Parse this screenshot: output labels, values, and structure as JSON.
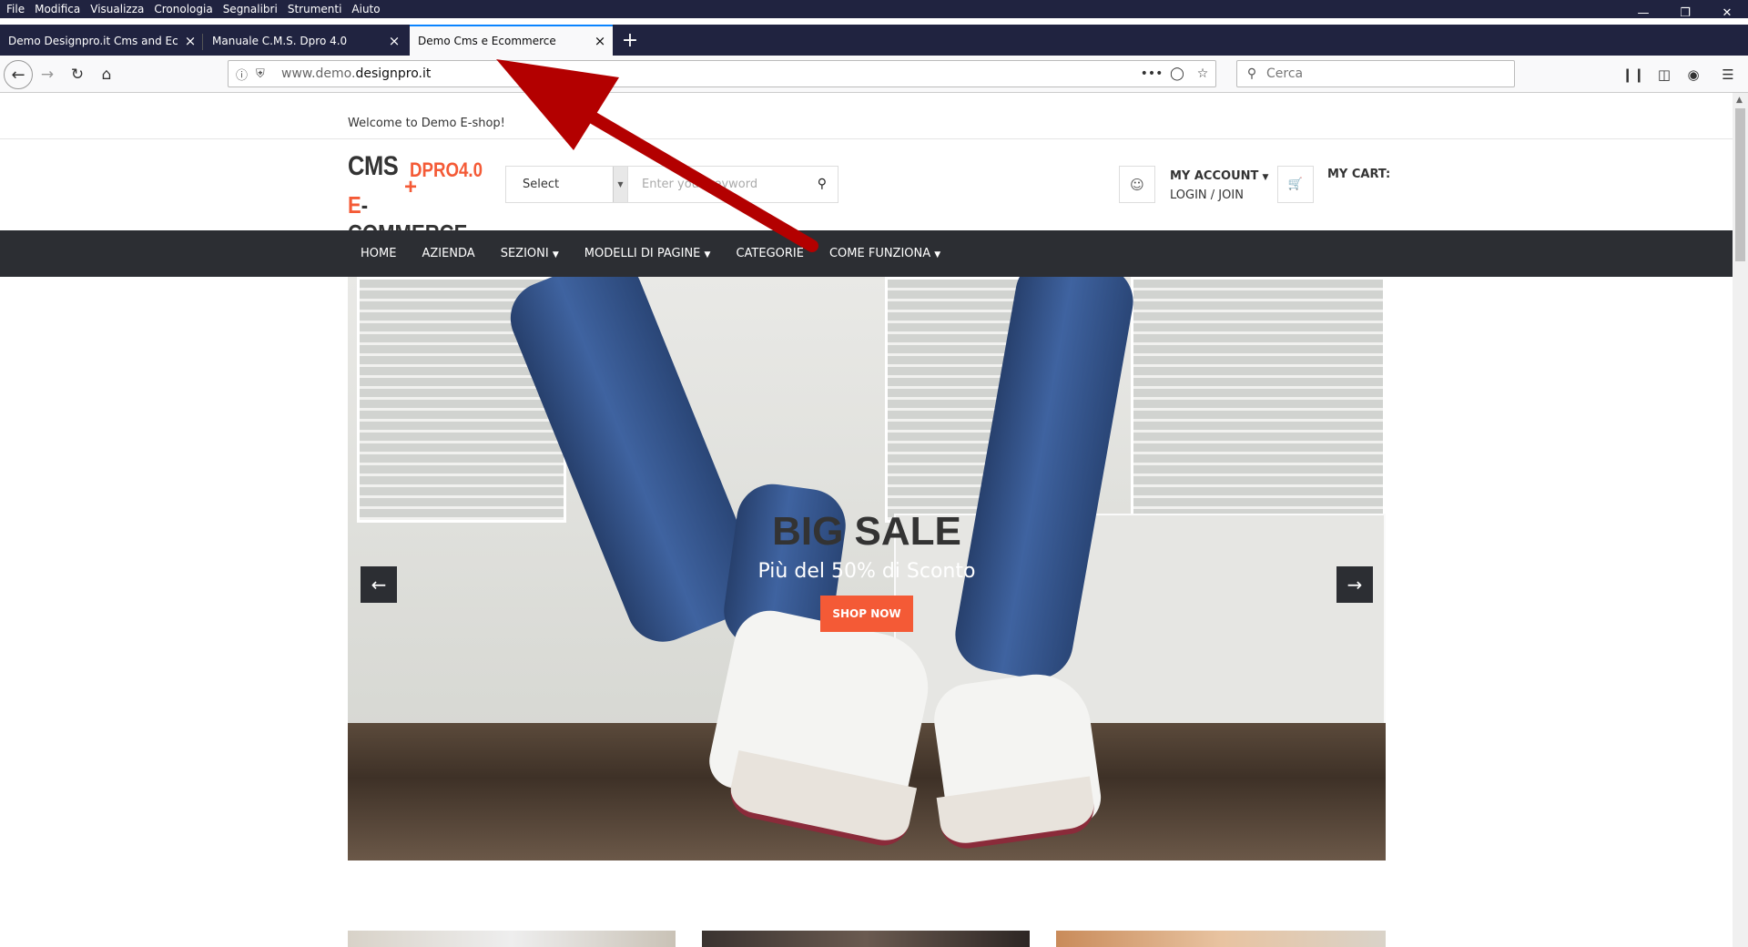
{
  "browser": {
    "menu": [
      "File",
      "Modifica",
      "Visualizza",
      "Cronologia",
      "Segnalibri",
      "Strumenti",
      "Aiuto"
    ],
    "tabs": [
      {
        "title": "Demo Designpro.it Cms and Ecomm"
      },
      {
        "title": "Manuale C.M.S. Dpro 4.0"
      },
      {
        "title": "Demo Cms e Ecommerce"
      }
    ],
    "url_prefix": "www.demo.",
    "url_domain": "designpro.it",
    "search_placeholder": "Cerca"
  },
  "site": {
    "welcome": "Welcome to Demo E-shop!",
    "logo": {
      "line1": "CMS",
      "line1b": "DPRO4.0",
      "plus": "+",
      "line2_e": "E",
      "line2_rest": "-COMMERCE"
    },
    "select_label": "Select",
    "keyword_placeholder": "Enter your keyword",
    "account_label": "MY ACCOUNT",
    "login_label": "LOGIN / JOIN",
    "cart_label": "MY CART:",
    "nav": [
      "HOME",
      "AZIENDA",
      "SEZIONI",
      "MODELLI DI PAGINE",
      "CATEGORIE",
      "COME FUNZIONA"
    ],
    "hero": {
      "title": "BIG SALE",
      "subtitle": "Più del 50% di Sconto",
      "button": "SHOP NOW"
    }
  },
  "colors": {
    "accent": "#f45a36",
    "dark": "#2c2e33",
    "browser": "#202340",
    "annotation": "#b30000"
  }
}
